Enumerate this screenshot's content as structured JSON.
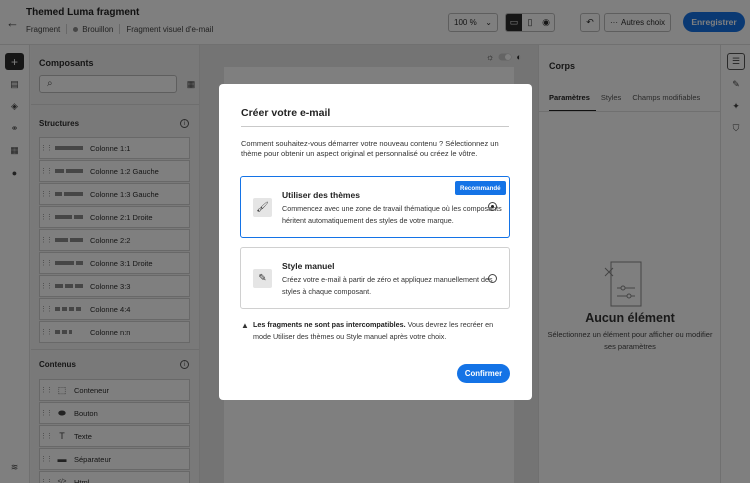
{
  "topbar": {
    "title": "Themed Luma fragment",
    "crumb_type": "Fragment",
    "crumb_status": "Brouillon",
    "crumb_editor": "Fragment visuel d'e-mail",
    "zoom": "100 %",
    "more_label": "Autres choix",
    "save_label": "Enregistrer"
  },
  "components": {
    "title": "Composants",
    "structures_title": "Structures",
    "structures": [
      {
        "label": "Colonne 1:1",
        "bars": [
          28
        ]
      },
      {
        "label": "Colonne 1:2 Gauche",
        "bars": [
          9,
          17
        ]
      },
      {
        "label": "Colonne 1:3 Gauche",
        "bars": [
          7,
          19
        ]
      },
      {
        "label": "Colonne 2:1 Droite",
        "bars": [
          17,
          9
        ]
      },
      {
        "label": "Colonne 2:2",
        "bars": [
          13,
          13
        ]
      },
      {
        "label": "Colonne 3:1 Droite",
        "bars": [
          19,
          7
        ]
      },
      {
        "label": "Colonne 3:3",
        "bars": [
          8,
          8,
          8
        ]
      },
      {
        "label": "Colonne 4:4",
        "bars": [
          5,
          5,
          5,
          5
        ]
      },
      {
        "label": "Colonne n:n",
        "bars": [
          5,
          5,
          3
        ]
      }
    ],
    "contents_title": "Contenus",
    "contents": [
      {
        "label": "Conteneur",
        "icon": "container-icon"
      },
      {
        "label": "Bouton",
        "icon": "button-icon"
      },
      {
        "label": "Texte",
        "icon": "text-icon"
      },
      {
        "label": "Séparateur",
        "icon": "divider-icon"
      },
      {
        "label": "Html",
        "icon": "html-icon"
      }
    ]
  },
  "right_panel": {
    "title": "Corps",
    "tabs": [
      "Paramètres",
      "Styles",
      "Champs modifiables"
    ],
    "empty_title": "Aucun élément",
    "empty_desc": "Sélectionnez un élément pour afficher ou modifier ses paramètres"
  },
  "modal": {
    "title": "Créer votre e-mail",
    "intro": "Comment souhaitez-vous démarrer votre nouveau contenu ? Sélectionnez un thème pour obtenir un aspect original et personnalisé ou créez le vôtre.",
    "option1_title": "Utiliser des thèmes",
    "option1_badge": "Recommandé",
    "option1_desc": "Commencez avec une zone de travail thématique où les composants héritent automatiquement des styles de votre marque.",
    "option2_title": "Style manuel",
    "option2_desc": "Créez votre e-mail à partir de zéro et appliquez manuellement des styles à chaque composant.",
    "warning_bold": "Les fragments ne sont pas intercompatibles.",
    "warning_text": " Vous devrez les recréer en mode Utiliser des thèmes ou Style manuel après votre choix.",
    "confirm_label": "Confirmer"
  },
  "colors": {
    "accent": "#1473e6"
  }
}
